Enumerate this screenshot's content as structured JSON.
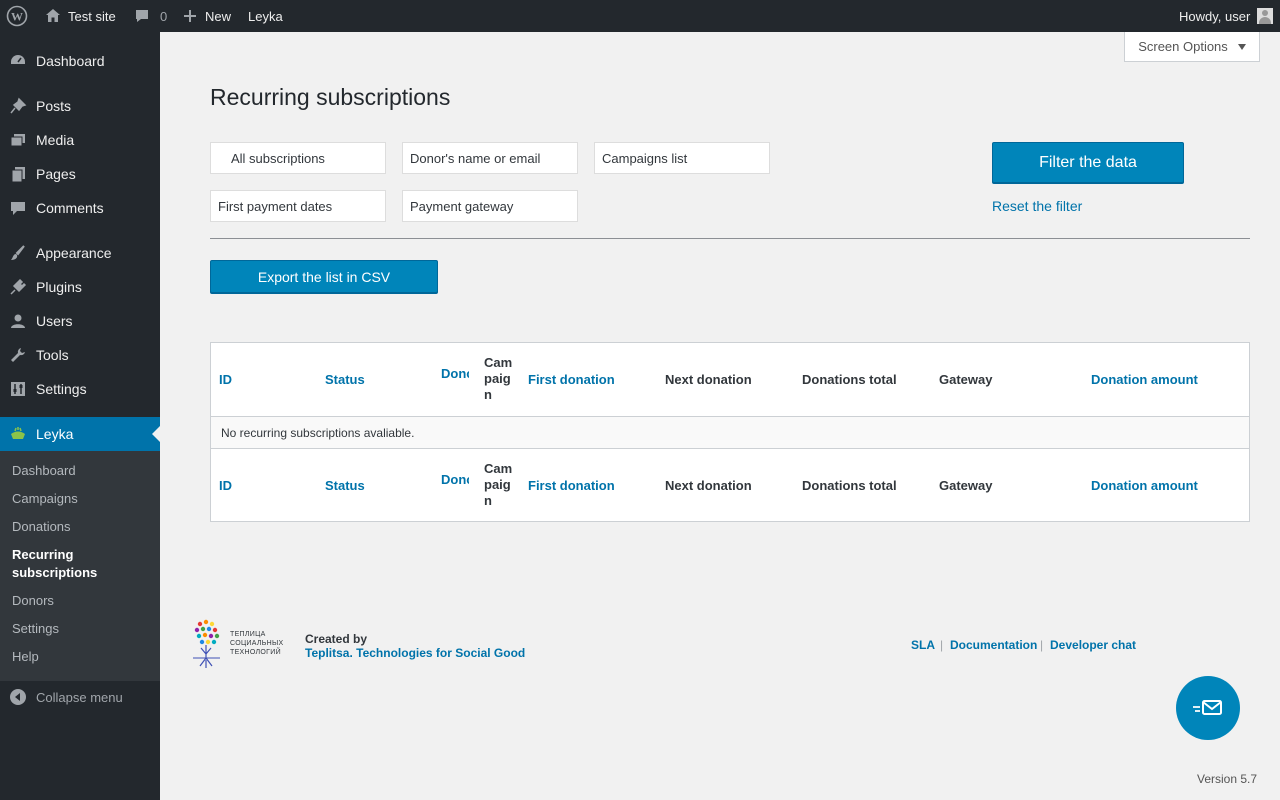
{
  "adminbar": {
    "site_name": "Test site",
    "comments_count": "0",
    "new_label": "New",
    "plugin_label": "Leyka",
    "greeting": "Howdy, user"
  },
  "sidebar": {
    "items": [
      {
        "label": "Dashboard",
        "icon": "dashboard-icon"
      },
      {
        "label": "Posts",
        "icon": "pin-icon"
      },
      {
        "label": "Media",
        "icon": "media-icon"
      },
      {
        "label": "Pages",
        "icon": "pages-icon"
      },
      {
        "label": "Comments",
        "icon": "comment-icon"
      },
      {
        "label": "Appearance",
        "icon": "brush-icon"
      },
      {
        "label": "Plugins",
        "icon": "plugin-icon"
      },
      {
        "label": "Users",
        "icon": "user-icon"
      },
      {
        "label": "Tools",
        "icon": "wrench-icon"
      },
      {
        "label": "Settings",
        "icon": "settings-icon"
      },
      {
        "label": "Leyka",
        "icon": "leyka-icon"
      }
    ],
    "submenu": [
      "Dashboard",
      "Campaigns",
      "Donations",
      "Recurring subscriptions",
      "Donors",
      "Settings",
      "Help"
    ],
    "collapse_label": "Collapse menu"
  },
  "screen_options_label": "Screen Options",
  "page_title": "Recurring subscriptions",
  "filters": {
    "status": "All subscriptions",
    "donor": "Donor's name or email",
    "campaigns": "Campaigns list",
    "first_payment": "First payment dates",
    "gateway": "Payment gateway",
    "filter_button": "Filter the data",
    "reset_link": "Reset the filter"
  },
  "export_button": "Export the list in CSV",
  "table": {
    "columns": [
      {
        "label": "ID"
      },
      {
        "label": "Status"
      },
      {
        "label": "Donor"
      },
      {
        "label": "Campaign"
      },
      {
        "label": "First donation"
      },
      {
        "label": "Next donation"
      },
      {
        "label": "Donations total"
      },
      {
        "label": "Gateway"
      },
      {
        "label": "Donation amount"
      }
    ],
    "empty_message": "No recurring subscriptions avaliable."
  },
  "footer": {
    "logo_text": [
      "ТЕПЛИЦА",
      "СОЦИАЛЬНЫХ",
      "ТЕХНОЛОГИЙ"
    ],
    "created_by": "Created by",
    "created_link": "Teplitsa. Technologies for Social Good",
    "links": [
      "SLA",
      "Documentation",
      "Developer chat"
    ],
    "version": "Version 5.7"
  },
  "colors": {
    "accent": "#0073aa",
    "button": "#0085ba",
    "sidebar_bg": "#23282d",
    "submenu_bg": "#32373c"
  }
}
